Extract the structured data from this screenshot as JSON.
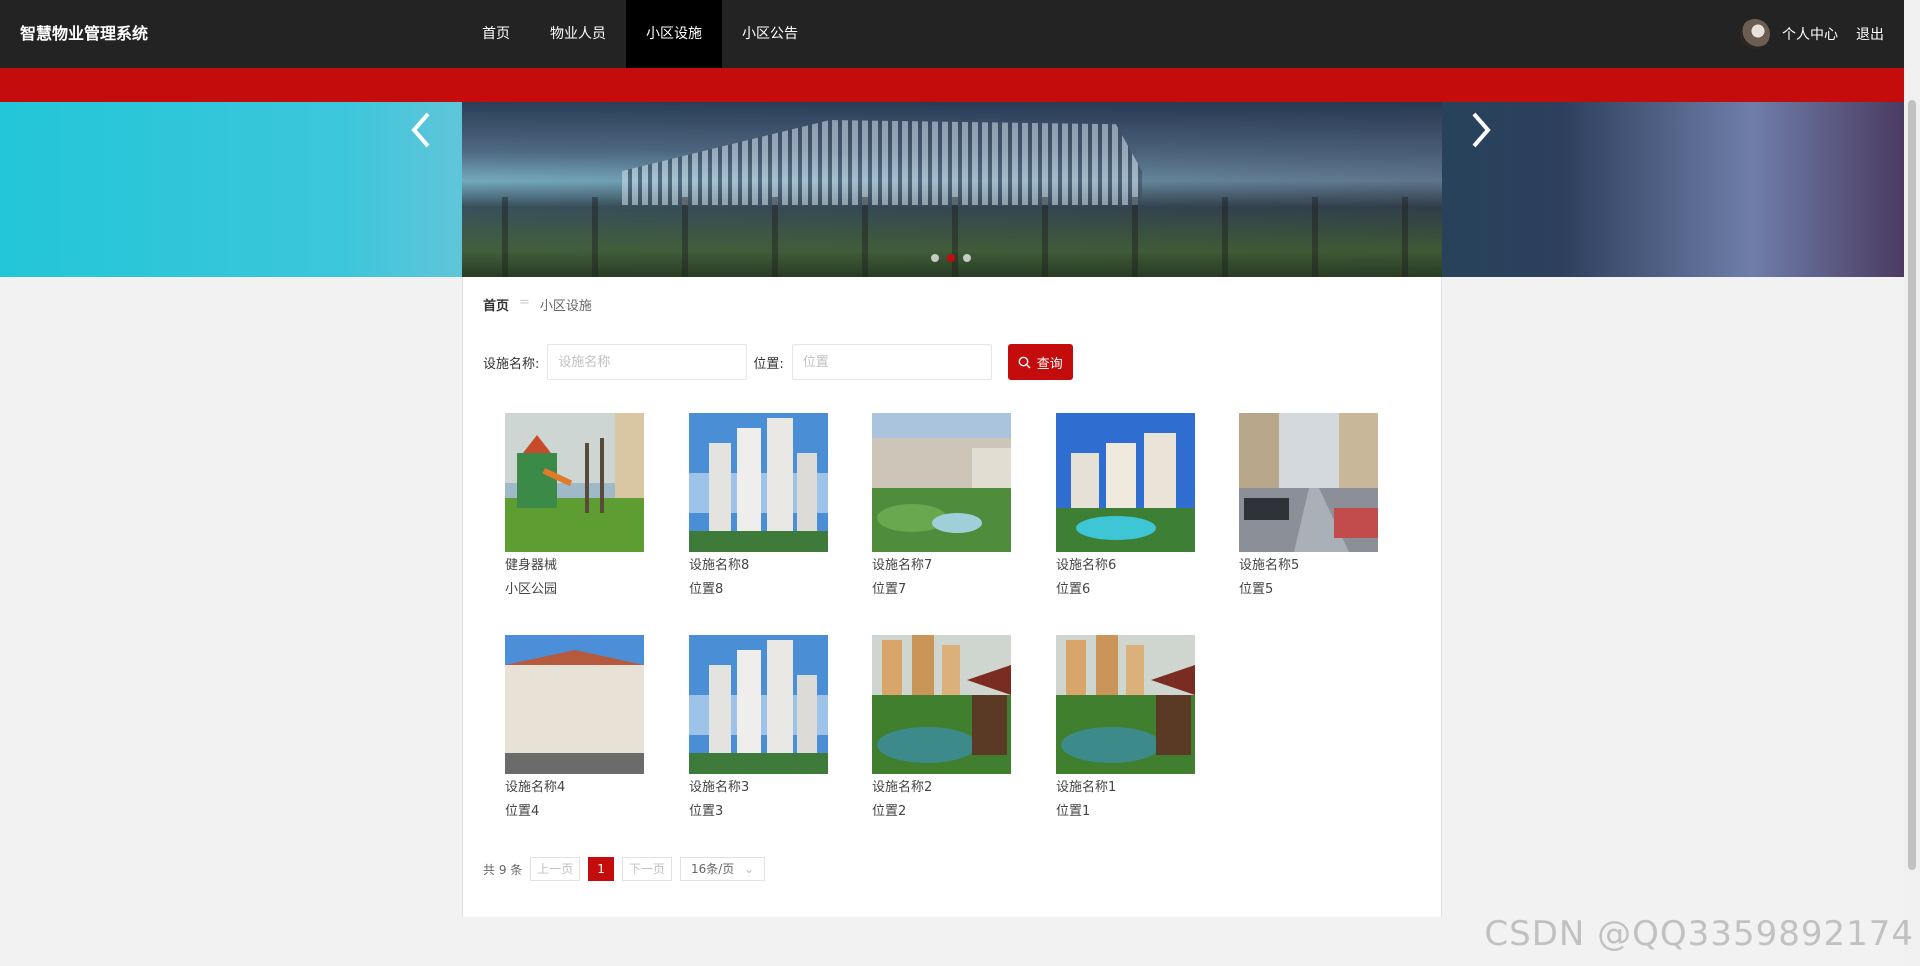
{
  "app": {
    "title": "智慧物业管理系统"
  },
  "nav": {
    "items": [
      {
        "label": "首页",
        "active": false
      },
      {
        "label": "物业人员",
        "active": false
      },
      {
        "label": "小区设施",
        "active": true
      },
      {
        "label": "小区公告",
        "active": false
      }
    ]
  },
  "user": {
    "profile_label": "个人中心",
    "logout_label": "退出"
  },
  "banner": {
    "dots": 3,
    "active_dot": 2
  },
  "breadcrumb": {
    "home": "首页",
    "separator": "=",
    "current": "小区设施"
  },
  "search": {
    "name_label": "设施名称:",
    "name_placeholder": "设施名称",
    "location_label": "位置:",
    "location_placeholder": "位置",
    "button_label": "查询"
  },
  "facilities": [
    {
      "name": "健身器械",
      "location": "小区公园",
      "image": "playground"
    },
    {
      "name": "设施名称8",
      "location": "位置8",
      "image": "towers"
    },
    {
      "name": "设施名称7",
      "location": "位置7",
      "image": "garden-estate"
    },
    {
      "name": "设施名称6",
      "location": "位置6",
      "image": "pool-estate"
    },
    {
      "name": "设施名称5",
      "location": "位置5",
      "image": "parking-street"
    },
    {
      "name": "设施名称4",
      "location": "位置4",
      "image": "apartment-block"
    },
    {
      "name": "设施名称3",
      "location": "位置3",
      "image": "towers"
    },
    {
      "name": "设施名称2",
      "location": "位置2",
      "image": "pond-pavilion"
    },
    {
      "name": "设施名称1",
      "location": "位置1",
      "image": "pond-pavilion"
    }
  ],
  "pagination": {
    "total_text": "共 9 条",
    "prev_label": "上一页",
    "current_page": "1",
    "next_label": "下一页",
    "page_size_label": "16条/页"
  },
  "watermark": "CSDN @QQ3359892174",
  "colors": {
    "accent": "#c40c0c",
    "topbar": "#232323"
  }
}
